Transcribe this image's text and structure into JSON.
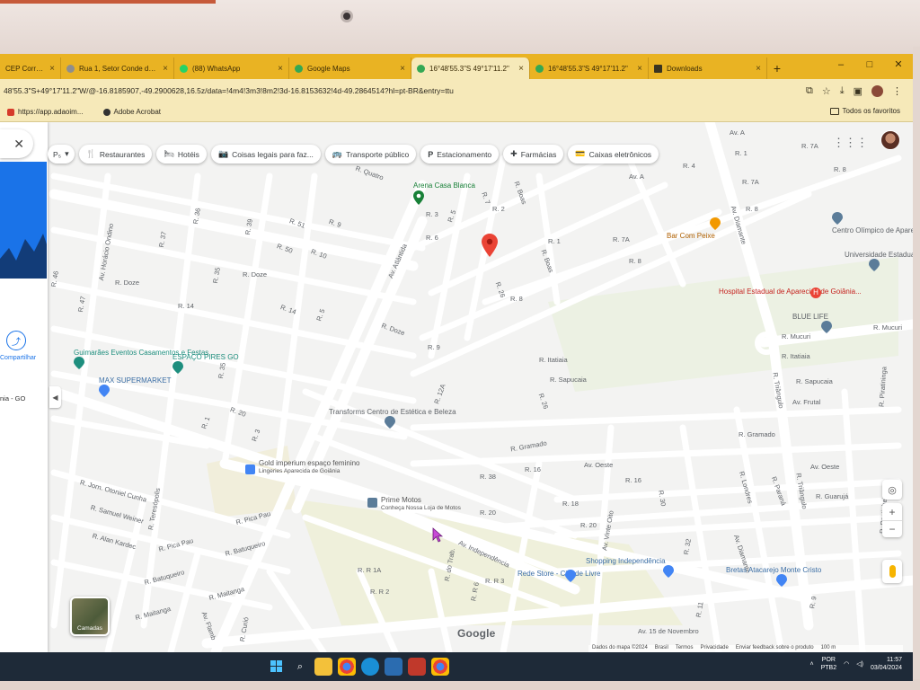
{
  "browser": {
    "tabs": [
      {
        "title": "CEP Correios",
        "color": "#2a6ebb"
      },
      {
        "title": "Rua 1, Setor Conde dos A",
        "color": "#8e8e8e"
      },
      {
        "title": "(88) WhatsApp",
        "color": "#25d366"
      },
      {
        "title": "Google Maps",
        "color": "#34a853"
      },
      {
        "title": "16°48'55.3\"S 49°17'11.2\"",
        "color": "#34a853",
        "active": true
      },
      {
        "title": "16°48'55.3\"S 49°17'11.2\"",
        "color": "#34a853"
      },
      {
        "title": "Downloads",
        "color": "#3a3420"
      }
    ],
    "new_tab": "+",
    "window_controls": [
      "–",
      "□",
      "✕"
    ],
    "url": "48'55.3\"S+49°17'11.2\"W/@-16.8185907,-49.2900628,16.5z/data=!4m4!3m3!8m2!3d-16.8153632!4d-49.2864514?hl=pt-BR&entry=ttu",
    "bookmarks": [
      {
        "label": "https://app.adaoim..."
      },
      {
        "label": "Adobe Acrobat"
      }
    ],
    "all_bookmarks": "Todos os favoritos"
  },
  "map": {
    "chips": [
      {
        "icon": "🍴",
        "label": "Restaurantes"
      },
      {
        "icon": "🛏",
        "label": "Hotéis"
      },
      {
        "icon": "📷",
        "label": "Coisas legais para faz..."
      },
      {
        "icon": "🚌",
        "label": "Transporte público"
      },
      {
        "icon": "P",
        "label": "Estacionamento"
      },
      {
        "icon": "✚",
        "label": "Farmácias"
      },
      {
        "icon": "💳",
        "label": "Caixas eletrônicos"
      }
    ],
    "mode_label": "P₅",
    "side": {
      "close": "✕",
      "share_label": "Compartilhar",
      "city": "nia - GO",
      "collapse": "◀"
    },
    "layers_label": "Camadas",
    "google_logo": "Google",
    "footer": [
      "Dados do mapa ©2024",
      "Brasil",
      "Termos",
      "Privacidade",
      "Enviar feedback sobre o produto",
      "100 m"
    ],
    "zoom_in": "+",
    "zoom_out": "−",
    "pois": [
      {
        "label": "Arena Casa Blanca",
        "cls": "green"
      },
      {
        "label": "Centro Olímpico de Aparecida",
        "cls": "gray"
      },
      {
        "label": "Bar Com Peixe",
        "cls": "orange"
      },
      {
        "label": "Universidade Estadual de Goiás - Aparecida...",
        "cls": "gray"
      },
      {
        "label": "Hospital Estadual de Aparecida de Goiânia...",
        "cls": "red"
      },
      {
        "label": "BLUE LIFE",
        "cls": "gray"
      },
      {
        "label": "Guimarães Eventos Casamentos e Festas",
        "cls": "teal"
      },
      {
        "label": "ESPAÇO PIRES GO",
        "cls": "teal"
      },
      {
        "label": "MAX SUPERMARKET",
        "cls": "blue"
      },
      {
        "label": "Transforms Centro de Estética e Beleza",
        "cls": "gray"
      },
      {
        "label": "Gold imperium espaço feminino",
        "cls": "purple"
      },
      {
        "label": "Lingeries Aparecida de Goiânia",
        "cls": "gray"
      },
      {
        "label": "Prime Motos",
        "cls": "purple"
      },
      {
        "label": "Conheça Nossa Loja de Motos",
        "cls": "gray"
      },
      {
        "label": "Shopping Independência",
        "cls": "blue"
      },
      {
        "label": "Rede Store - Cidade Livre",
        "cls": "blue"
      },
      {
        "label": "Bretas Atacarejo Monte Cristo",
        "cls": "blue"
      }
    ],
    "roads": [
      "Av. A",
      "R. 7A",
      "R. 1",
      "R. 8",
      "R. 7A",
      "R. 8",
      "Av. Diamante",
      "Av. A",
      "R. 4",
      "R. 2",
      "R. Boas",
      "R. 7",
      "R. 1",
      "R. 7A",
      "R. 8",
      "R. Boas",
      "R. 3",
      "R. 5",
      "R. 6",
      "Av. Atlântida",
      "R. Quatro",
      "R. 9",
      "R. 10",
      "R. 50",
      "R. 51",
      "R. 36",
      "R. 39",
      "R. 37",
      "Av. Horácio Ondino",
      "R. 46",
      "R. 47",
      "R. Doze",
      "R. 35",
      "R. Doze",
      "R. 14",
      "R. 14",
      "R. 5",
      "R. Doze",
      "R. 8",
      "R. 9",
      "R. 26",
      "R. 12A",
      "R. Mucuri",
      "R. Mucuri",
      "R. Itatiaia",
      "R. Itatiaia",
      "R. Sapucaia",
      "R. Sapucaia",
      "R. Triângulo",
      "Av. Frutal",
      "R. Gramado",
      "R. Gramado",
      "R. 26",
      "Av. Oeste",
      "Av. Oeste",
      "R. 16",
      "R. 16",
      "R. 38",
      "R. 20",
      "R. 18",
      "R. 20",
      "R. 30",
      "R. Londres",
      "R. Paraná",
      "R. Triângulo",
      "R. Guarujá",
      "R. Pastinheira",
      "R. Piratininga",
      "R. 1",
      "R. 3",
      "R. 20",
      "R. 35",
      "R. Jorn. Otoniel Cunha",
      "R. Samuel Weiner",
      "R. Alan Kardec",
      "R. Teresópolis",
      "R. Pica Pau",
      "R. Pica Pau",
      "R. Batuqueiro",
      "R. Batuqueiro",
      "R. Maitanga",
      "R. Maitanga",
      "Av. Independência",
      "R. R 1A",
      "R. R 2",
      "R. R 3",
      "R. R 6",
      "R. do Trab.",
      "Av. Vinte Oito",
      "R. 32",
      "Av. Diamante",
      "Av. 15 de Novembro",
      "R. 11",
      "R. 9",
      "Av. Flamb",
      "R. Curió"
    ]
  },
  "taskbar": {
    "language": [
      "POR",
      "PTB2"
    ],
    "time": "11:57",
    "date": "03/04/2024"
  },
  "colors": {
    "tabstrip": "#e9b323",
    "pin": "#ea4335",
    "accent": "#1a73e8"
  }
}
